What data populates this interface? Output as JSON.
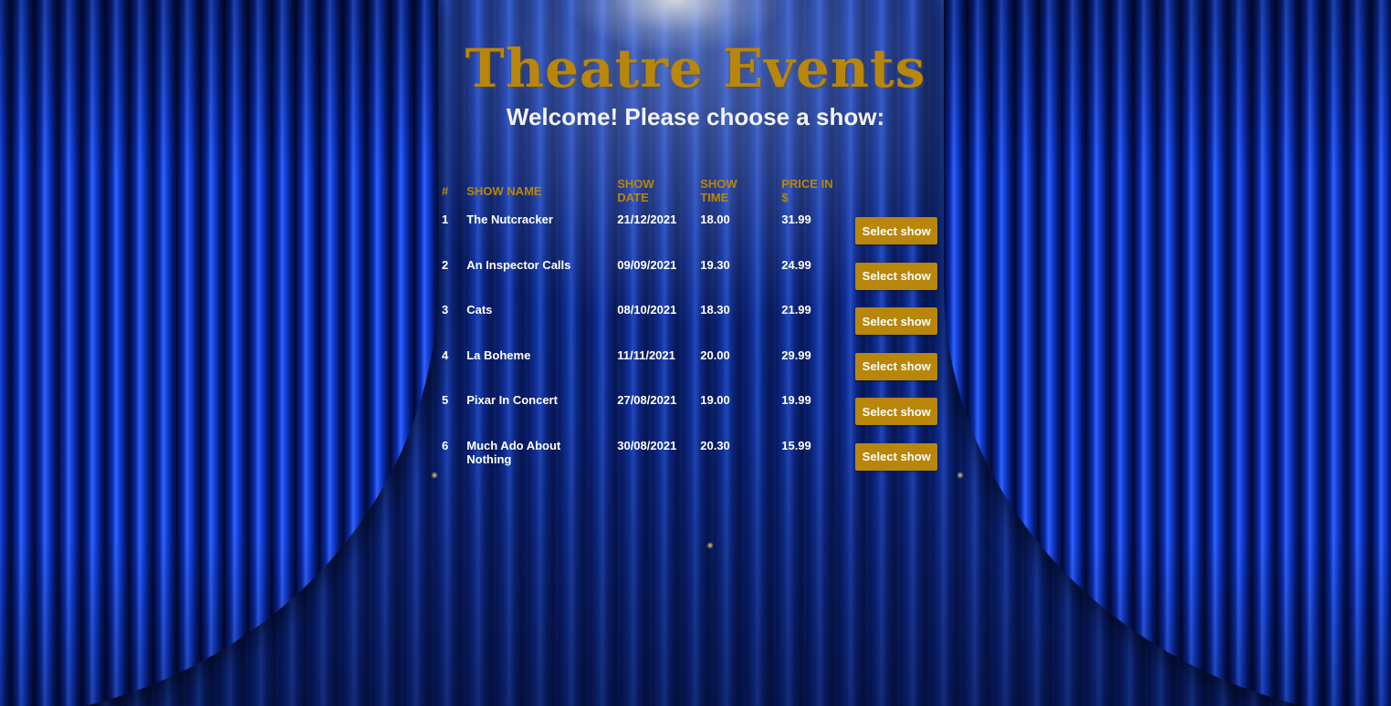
{
  "header": {
    "title": "Theatre Events",
    "subtitle": "Welcome! Please choose a show:"
  },
  "table": {
    "columns": [
      "#",
      "Show name",
      "Show date",
      "Show time",
      "Price in $",
      ""
    ],
    "rows": [
      {
        "num": "1",
        "name": "The Nutcracker",
        "date": "21/12/2021",
        "time": "18.00",
        "price": "31.99",
        "action": "Select show"
      },
      {
        "num": "2",
        "name": "An Inspector Calls",
        "date": "09/09/2021",
        "time": "19.30",
        "price": "24.99",
        "action": "Select show"
      },
      {
        "num": "3",
        "name": "Cats",
        "date": "08/10/2021",
        "time": "18.30",
        "price": "21.99",
        "action": "Select show"
      },
      {
        "num": "4",
        "name": "La Boheme",
        "date": "11/11/2021",
        "time": "20.00",
        "price": "29.99",
        "action": "Select show"
      },
      {
        "num": "5",
        "name": "Pixar In Concert",
        "date": "27/08/2021",
        "time": "19.00",
        "price": "19.99",
        "action": "Select show"
      },
      {
        "num": "6",
        "name": "Much Ado About Nothing",
        "date": "30/08/2021",
        "time": "20.30",
        "price": "15.99",
        "action": "Select show"
      }
    ]
  },
  "colors": {
    "accent": "#b8860b",
    "text": "#ffffff",
    "curtain": "#1340d8"
  }
}
